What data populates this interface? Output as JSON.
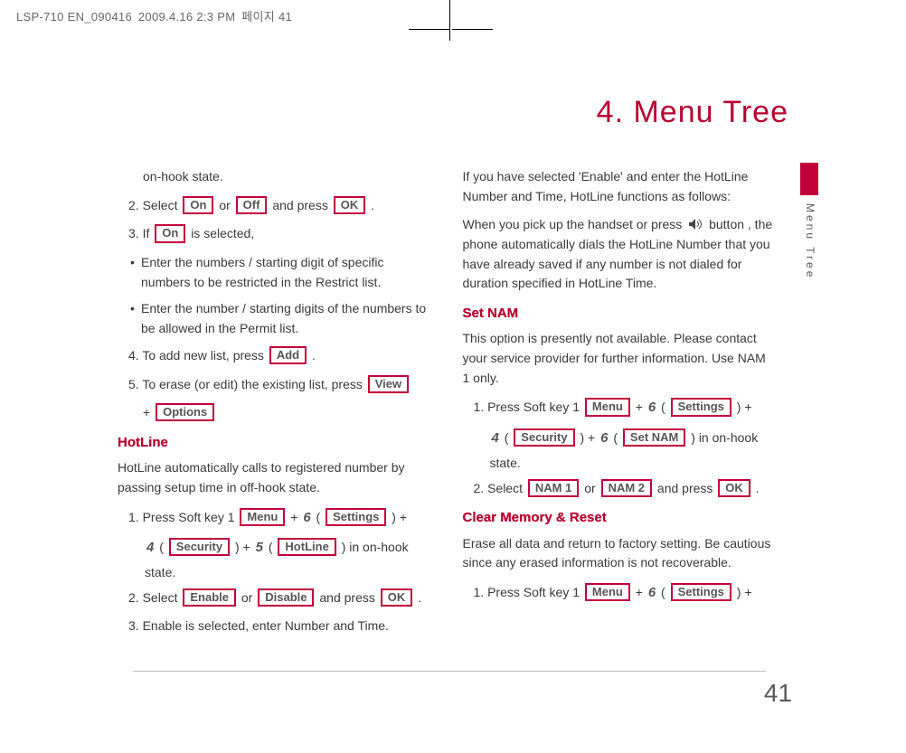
{
  "header": {
    "file": "LSP-710 EN_090416",
    "timestamp": "2009.4.16 2:3 PM",
    "pagelabel": "페이지 41"
  },
  "chapter": "4. Menu Tree",
  "side_text": "Menu Tree",
  "page_number": "41",
  "buttons": {
    "on": "On",
    "off": "Off",
    "ok": "OK",
    "add": "Add",
    "view": "View",
    "options": "Options",
    "menu": "Menu",
    "settings": "Settings",
    "security": "Security",
    "hotline": "HotLine",
    "enable": "Enable",
    "disable": "Disable",
    "set_nam": "Set NAM",
    "nam1": "NAM 1",
    "nam2": "NAM 2"
  },
  "left": {
    "p0": "on-hook state.",
    "p1a": "2. Select ",
    "p1b": " or ",
    "p1c": " and press ",
    "p1d": " .",
    "p2a": "3. If ",
    "p2b": " is selected,",
    "b1": "Enter the numbers / starting digit of specific numbers to be restricted in the Restrict list.",
    "b2": "Enter the number / starting digits of the numbers to be allowed in the Permit list.",
    "p3a": "4. To add new list, press ",
    "p3b": " .",
    "p4a": "5. To erase (or edit) the existing list, press ",
    "p4plus": "+ ",
    "sec1": "HotLine",
    "desc1": "HotLine automatically calls to registered number by passing setup time in off-hook state.",
    "s1a": "1. Press Soft key 1 ",
    "s1plus": " + ",
    "s1k6": "6",
    "s1op": " ( ",
    "s1cp": " ) + ",
    "s1k4": "4",
    "s1k5": "5",
    "s1end": " ) in on-hook",
    "s1state": "state.",
    "s2a": "2. Select ",
    "s2or": " or ",
    "s2press": " and press ",
    "s2dot": " .",
    "s3": "3. Enable is selected, enter Number and Time."
  },
  "right": {
    "p1": "If you have selected 'Enable' and enter the HotLine Number and Time, HotLine functions as follows:",
    "p2a": "When you pick up the handset or press ",
    "p2b": " button , the phone automatically dials the HotLine Number that you have already saved if any number is not dialed for duration specified in HotLine Time.",
    "sec2": "Set NAM",
    "desc2": "This option is presently not available. Please contact your service provider for further information. Use NAM 1 only.",
    "r1a": "1. Press Soft key 1 ",
    "r1plus": " + ",
    "r1k6": "6",
    "r1k6b": "6",
    "r1k4": "4",
    "r1op": " ( ",
    "r1cp": " ) + ",
    "r1end": " ) in on-hook",
    "r1state": "state.",
    "r2a": "2. Select ",
    "r2or": " or ",
    "r2press": " and press ",
    "r2dot": " .",
    "sec3": "Clear Memory & Reset",
    "desc3": "Erase all data and return to factory setting. Be cautious since any erased information is not recoverable.",
    "r3a": "1. Press Soft key 1 ",
    "r3plus": " + ",
    "r3k6": "6",
    "r3op": " ( ",
    "r3cp": " ) + "
  }
}
